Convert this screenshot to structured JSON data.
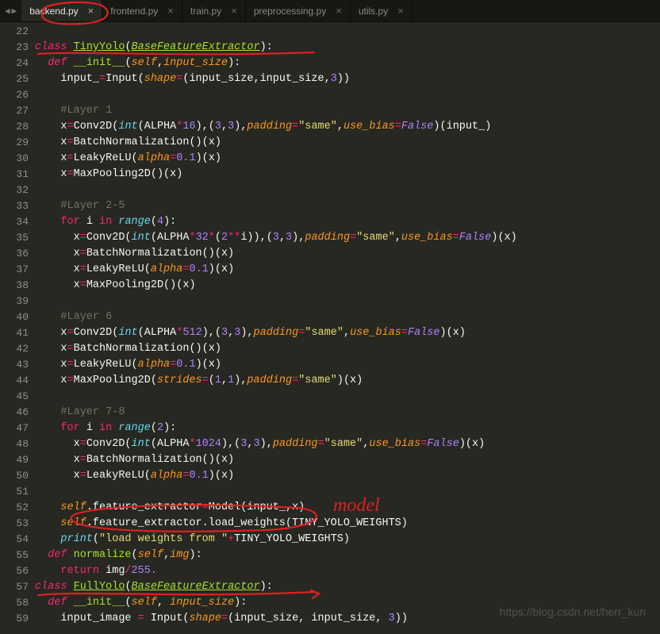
{
  "nav": {
    "prev": "◀",
    "next": "▶"
  },
  "tabs": [
    {
      "label": "backend.py",
      "active": true
    },
    {
      "label": "frontend.py",
      "active": false
    },
    {
      "label": "train.py",
      "active": false
    },
    {
      "label": "preprocessing.py",
      "active": false
    },
    {
      "label": "utils.py",
      "active": false
    }
  ],
  "gutter": {
    "start": 22,
    "end": 59
  },
  "code": {
    "22": [],
    "23": [
      [
        "kw",
        "class"
      ],
      [
        "plain",
        " "
      ],
      [
        "cls",
        "TinyYolo"
      ],
      [
        "plain",
        "("
      ],
      [
        "base",
        "BaseFeatureExtractor"
      ],
      [
        "plain",
        "):"
      ]
    ],
    "24": [
      [
        "plain",
        "  "
      ],
      [
        "kw",
        "def"
      ],
      [
        "plain",
        " "
      ],
      [
        "fn",
        "__init__"
      ],
      [
        "plain",
        "("
      ],
      [
        "arg",
        "self"
      ],
      [
        "plain",
        ","
      ],
      [
        "arg",
        "input_size"
      ],
      [
        "plain",
        "):"
      ]
    ],
    "25": [
      [
        "plain",
        "    input_"
      ],
      [
        "op",
        "="
      ],
      [
        "plain",
        "Input("
      ],
      [
        "arg",
        "shape"
      ],
      [
        "op",
        "="
      ],
      [
        "plain",
        "(input_size,input_size,"
      ],
      [
        "num",
        "3"
      ],
      [
        "plain",
        "))"
      ]
    ],
    "26": [],
    "27": [
      [
        "plain",
        "    "
      ],
      [
        "cmt",
        "#Layer 1"
      ]
    ],
    "28": [
      [
        "plain",
        "    x"
      ],
      [
        "op",
        "="
      ],
      [
        "plain",
        "Conv2D("
      ],
      [
        "builtin",
        "int"
      ],
      [
        "plain",
        "(ALPHA"
      ],
      [
        "op",
        "*"
      ],
      [
        "num",
        "16"
      ],
      [
        "plain",
        "),("
      ],
      [
        "num",
        "3"
      ],
      [
        "plain",
        ","
      ],
      [
        "num",
        "3"
      ],
      [
        "plain",
        "),"
      ],
      [
        "arg",
        "padding"
      ],
      [
        "op",
        "="
      ],
      [
        "str",
        "\"same\""
      ],
      [
        "plain",
        ","
      ],
      [
        "arg",
        "use_bias"
      ],
      [
        "op",
        "="
      ],
      [
        "bool",
        "False"
      ],
      [
        "plain",
        ")(input_)"
      ]
    ],
    "29": [
      [
        "plain",
        "    x"
      ],
      [
        "op",
        "="
      ],
      [
        "plain",
        "BatchNormalization()(x)"
      ]
    ],
    "30": [
      [
        "plain",
        "    x"
      ],
      [
        "op",
        "="
      ],
      [
        "plain",
        "LeakyReLU("
      ],
      [
        "arg",
        "alpha"
      ],
      [
        "op",
        "="
      ],
      [
        "num",
        "0.1"
      ],
      [
        "plain",
        ")(x)"
      ]
    ],
    "31": [
      [
        "plain",
        "    x"
      ],
      [
        "op",
        "="
      ],
      [
        "plain",
        "MaxPooling2D()(x)"
      ]
    ],
    "32": [],
    "33": [
      [
        "plain",
        "    "
      ],
      [
        "cmt",
        "#Layer 2-5"
      ]
    ],
    "34": [
      [
        "plain",
        "    "
      ],
      [
        "kw2",
        "for"
      ],
      [
        "plain",
        " i "
      ],
      [
        "kw2",
        "in"
      ],
      [
        "plain",
        " "
      ],
      [
        "builtin",
        "range"
      ],
      [
        "plain",
        "("
      ],
      [
        "num",
        "4"
      ],
      [
        "plain",
        "):"
      ]
    ],
    "35": [
      [
        "plain",
        "      x"
      ],
      [
        "op",
        "="
      ],
      [
        "plain",
        "Conv2D("
      ],
      [
        "builtin",
        "int"
      ],
      [
        "plain",
        "(ALPHA"
      ],
      [
        "op",
        "*"
      ],
      [
        "num",
        "32"
      ],
      [
        "op",
        "*"
      ],
      [
        "plain",
        "("
      ],
      [
        "num",
        "2"
      ],
      [
        "op",
        "**"
      ],
      [
        "plain",
        "i)),("
      ],
      [
        "num",
        "3"
      ],
      [
        "plain",
        ","
      ],
      [
        "num",
        "3"
      ],
      [
        "plain",
        "),"
      ],
      [
        "arg",
        "padding"
      ],
      [
        "op",
        "="
      ],
      [
        "str",
        "\"same\""
      ],
      [
        "plain",
        ","
      ],
      [
        "arg",
        "use_bias"
      ],
      [
        "op",
        "="
      ],
      [
        "bool",
        "False"
      ],
      [
        "plain",
        ")(x)"
      ]
    ],
    "36": [
      [
        "plain",
        "      x"
      ],
      [
        "op",
        "="
      ],
      [
        "plain",
        "BatchNormalization()(x)"
      ]
    ],
    "37": [
      [
        "plain",
        "      x"
      ],
      [
        "op",
        "="
      ],
      [
        "plain",
        "LeakyReLU("
      ],
      [
        "arg",
        "alpha"
      ],
      [
        "op",
        "="
      ],
      [
        "num",
        "0.1"
      ],
      [
        "plain",
        ")(x)"
      ]
    ],
    "38": [
      [
        "plain",
        "      x"
      ],
      [
        "op",
        "="
      ],
      [
        "plain",
        "MaxPooling2D()(x)"
      ]
    ],
    "39": [],
    "40": [
      [
        "plain",
        "    "
      ],
      [
        "cmt",
        "#Layer 6"
      ]
    ],
    "41": [
      [
        "plain",
        "    x"
      ],
      [
        "op",
        "="
      ],
      [
        "plain",
        "Conv2D("
      ],
      [
        "builtin",
        "int"
      ],
      [
        "plain",
        "(ALPHA"
      ],
      [
        "op",
        "*"
      ],
      [
        "num",
        "512"
      ],
      [
        "plain",
        "),("
      ],
      [
        "num",
        "3"
      ],
      [
        "plain",
        ","
      ],
      [
        "num",
        "3"
      ],
      [
        "plain",
        "),"
      ],
      [
        "arg",
        "padding"
      ],
      [
        "op",
        "="
      ],
      [
        "str",
        "\"same\""
      ],
      [
        "plain",
        ","
      ],
      [
        "arg",
        "use_bias"
      ],
      [
        "op",
        "="
      ],
      [
        "bool",
        "False"
      ],
      [
        "plain",
        ")(x)"
      ]
    ],
    "42": [
      [
        "plain",
        "    x"
      ],
      [
        "op",
        "="
      ],
      [
        "plain",
        "BatchNormalization()(x)"
      ]
    ],
    "43": [
      [
        "plain",
        "    x"
      ],
      [
        "op",
        "="
      ],
      [
        "plain",
        "LeakyReLU("
      ],
      [
        "arg",
        "alpha"
      ],
      [
        "op",
        "="
      ],
      [
        "num",
        "0.1"
      ],
      [
        "plain",
        ")(x)"
      ]
    ],
    "44": [
      [
        "plain",
        "    x"
      ],
      [
        "op",
        "="
      ],
      [
        "plain",
        "MaxPooling2D("
      ],
      [
        "arg",
        "strides"
      ],
      [
        "op",
        "="
      ],
      [
        "plain",
        "("
      ],
      [
        "num",
        "1"
      ],
      [
        "plain",
        ","
      ],
      [
        "num",
        "1"
      ],
      [
        "plain",
        "),"
      ],
      [
        "arg",
        "padding"
      ],
      [
        "op",
        "="
      ],
      [
        "str",
        "\"same\""
      ],
      [
        "plain",
        ")(x)"
      ]
    ],
    "45": [],
    "46": [
      [
        "plain",
        "    "
      ],
      [
        "cmt",
        "#Layer 7-8"
      ]
    ],
    "47": [
      [
        "plain",
        "    "
      ],
      [
        "kw2",
        "for"
      ],
      [
        "plain",
        " i "
      ],
      [
        "kw2",
        "in"
      ],
      [
        "plain",
        " "
      ],
      [
        "builtin",
        "range"
      ],
      [
        "plain",
        "("
      ],
      [
        "num",
        "2"
      ],
      [
        "plain",
        "):"
      ]
    ],
    "48": [
      [
        "plain",
        "      x"
      ],
      [
        "op",
        "="
      ],
      [
        "plain",
        "Conv2D("
      ],
      [
        "builtin",
        "int"
      ],
      [
        "plain",
        "(ALPHA"
      ],
      [
        "op",
        "*"
      ],
      [
        "num",
        "1024"
      ],
      [
        "plain",
        "),("
      ],
      [
        "num",
        "3"
      ],
      [
        "plain",
        ","
      ],
      [
        "num",
        "3"
      ],
      [
        "plain",
        "),"
      ],
      [
        "arg",
        "padding"
      ],
      [
        "op",
        "="
      ],
      [
        "str",
        "\"same\""
      ],
      [
        "plain",
        ","
      ],
      [
        "arg",
        "use_bias"
      ],
      [
        "op",
        "="
      ],
      [
        "bool",
        "False"
      ],
      [
        "plain",
        ")(x)"
      ]
    ],
    "49": [
      [
        "plain",
        "      x"
      ],
      [
        "op",
        "="
      ],
      [
        "plain",
        "BatchNormalization()(x)"
      ]
    ],
    "50": [
      [
        "plain",
        "      x"
      ],
      [
        "op",
        "="
      ],
      [
        "plain",
        "LeakyReLU("
      ],
      [
        "arg",
        "alpha"
      ],
      [
        "op",
        "="
      ],
      [
        "num",
        "0.1"
      ],
      [
        "plain",
        ")(x)"
      ]
    ],
    "51": [],
    "52": [
      [
        "plain",
        "    "
      ],
      [
        "arg",
        "self"
      ],
      [
        "plain",
        ".feature_extractor"
      ],
      [
        "op",
        "="
      ],
      [
        "plain",
        "Model(input_,x)"
      ]
    ],
    "53": [
      [
        "plain",
        "    "
      ],
      [
        "arg",
        "self"
      ],
      [
        "plain",
        ".feature_extractor.load_weights(TINY_YOLO_WEIGHTS)"
      ]
    ],
    "54": [
      [
        "plain",
        "    "
      ],
      [
        "builtin",
        "print"
      ],
      [
        "plain",
        "("
      ],
      [
        "str",
        "\"load weights from \""
      ],
      [
        "op",
        "+"
      ],
      [
        "plain",
        "TINY_YOLO_WEIGHTS)"
      ]
    ],
    "55": [
      [
        "plain",
        "  "
      ],
      [
        "kw",
        "def"
      ],
      [
        "plain",
        " "
      ],
      [
        "fn",
        "normalize"
      ],
      [
        "plain",
        "("
      ],
      [
        "arg",
        "self"
      ],
      [
        "plain",
        ","
      ],
      [
        "arg",
        "img"
      ],
      [
        "plain",
        "):"
      ]
    ],
    "56": [
      [
        "plain",
        "    "
      ],
      [
        "kw2",
        "return"
      ],
      [
        "plain",
        " img"
      ],
      [
        "op",
        "/"
      ],
      [
        "num",
        "255."
      ]
    ],
    "57": [
      [
        "kw",
        "class"
      ],
      [
        "plain",
        " "
      ],
      [
        "cls",
        "FullYolo"
      ],
      [
        "plain",
        "("
      ],
      [
        "base",
        "BaseFeatureExtractor"
      ],
      [
        "plain",
        "):"
      ]
    ],
    "58": [
      [
        "plain",
        "  "
      ],
      [
        "kw",
        "def"
      ],
      [
        "plain",
        " "
      ],
      [
        "fn",
        "__init__"
      ],
      [
        "plain",
        "("
      ],
      [
        "arg",
        "self"
      ],
      [
        "plain",
        ", "
      ],
      [
        "arg",
        "input_size"
      ],
      [
        "plain",
        "):"
      ]
    ],
    "59": [
      [
        "plain",
        "    input_image "
      ],
      [
        "op",
        "="
      ],
      [
        "plain",
        " Input("
      ],
      [
        "arg",
        "shape"
      ],
      [
        "op",
        "="
      ],
      [
        "plain",
        "(input_size, input_size, "
      ],
      [
        "num",
        "3"
      ],
      [
        "plain",
        "))"
      ]
    ]
  },
  "annotations": {
    "model_label": "model"
  },
  "watermark": "https://blog.csdn.net/herr_kun"
}
